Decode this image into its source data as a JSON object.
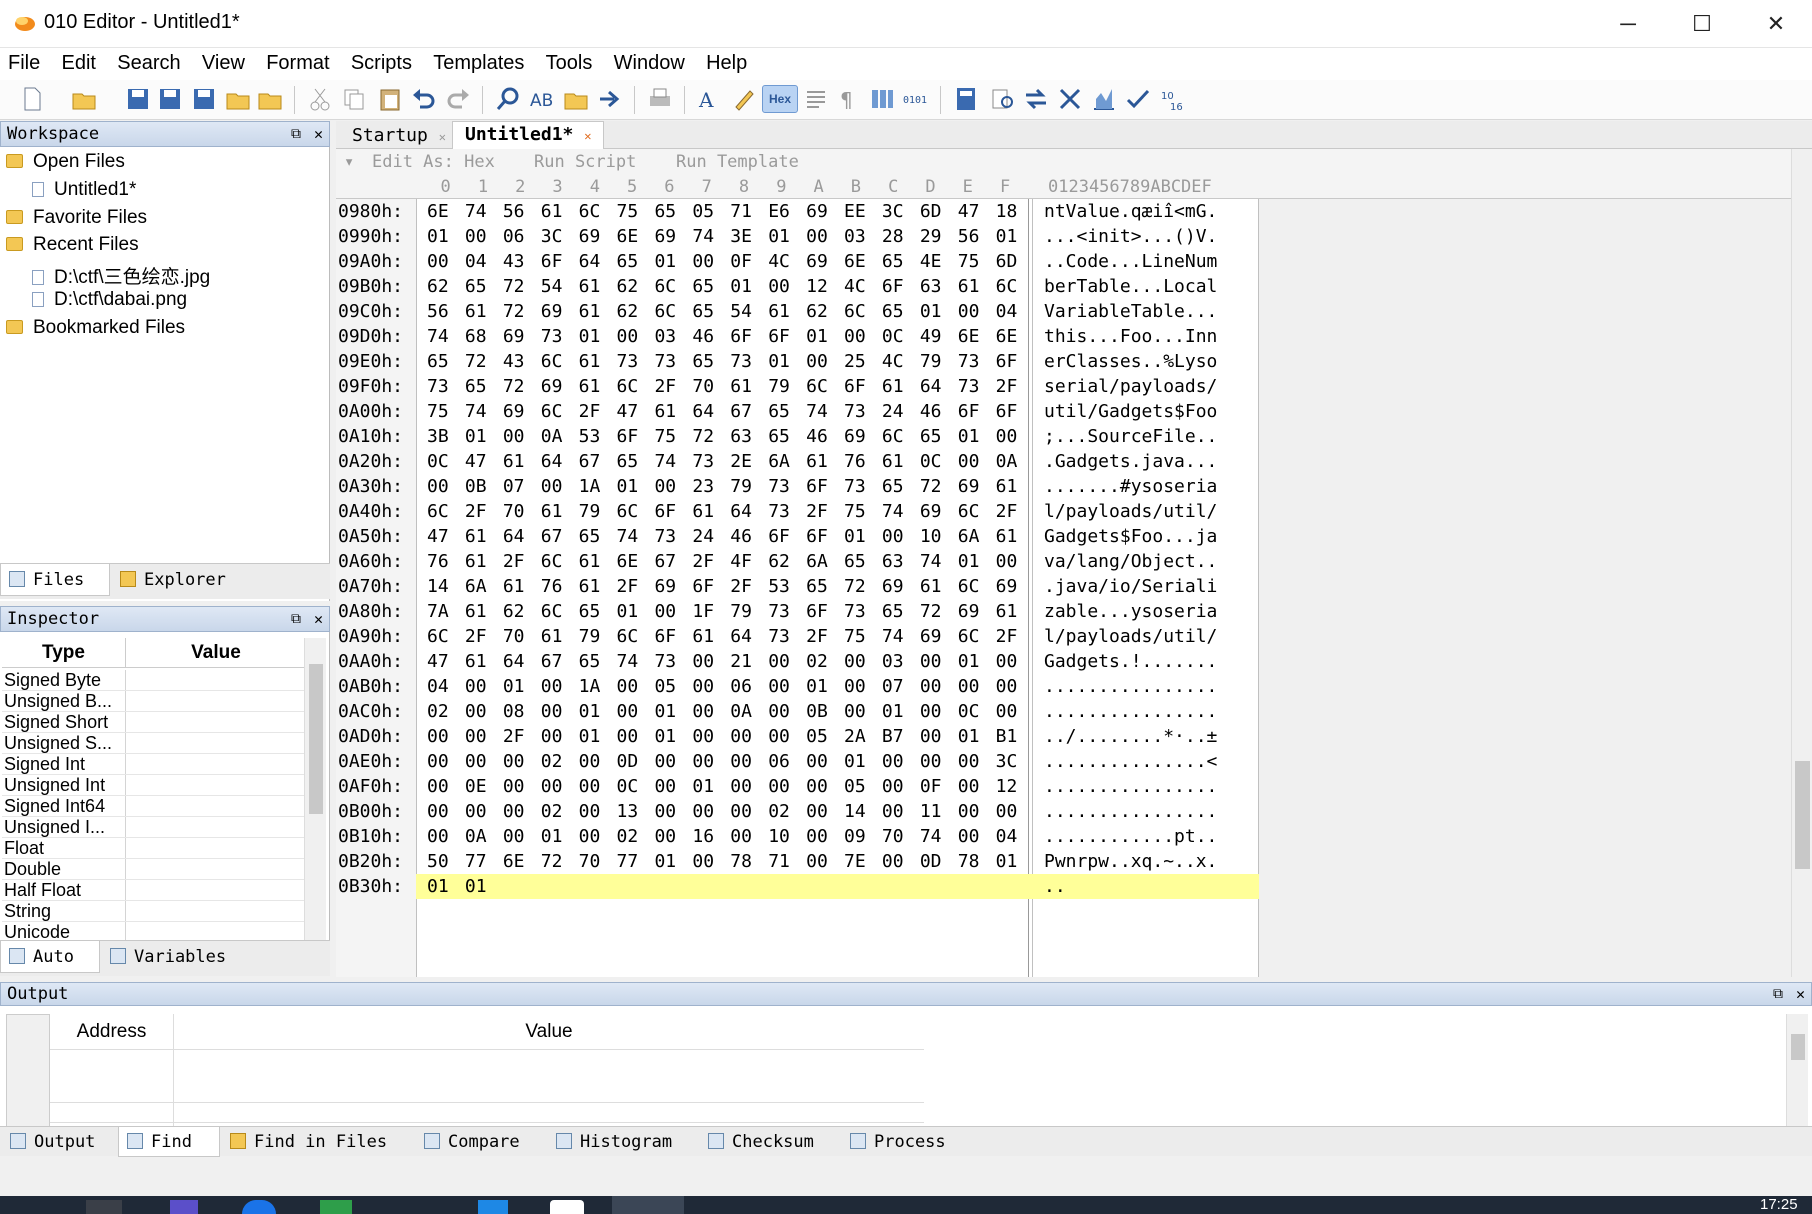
{
  "window": {
    "title": "010 Editor - Untitled1*",
    "minimize": "─",
    "maximize": "☐",
    "close": "✕"
  },
  "menu": [
    "File",
    "Edit",
    "Search",
    "View",
    "Format",
    "Scripts",
    "Templates",
    "Tools",
    "Window",
    "Help"
  ],
  "toolbar": {
    "hex_label": "Hex"
  },
  "workspace": {
    "title": "Workspace",
    "tree": {
      "open_files": "Open Files",
      "untitled": "Untitled1*",
      "favorite_files": "Favorite Files",
      "recent_files": "Recent Files",
      "recent1": "D:\\ctf\\三色绘恋.jpg",
      "recent2": "D:\\ctf\\dabai.png",
      "bookmarked_files": "Bookmarked Files"
    },
    "tabs": {
      "files": "Files",
      "explorer": "Explorer"
    }
  },
  "inspector": {
    "title": "Inspector",
    "col_type": "Type",
    "col_value": "Value",
    "rows": [
      "Signed Byte",
      "Unsigned B...",
      "Signed Short",
      "Unsigned S...",
      "Signed Int",
      "Unsigned Int",
      "Signed Int64",
      "Unsigned I...",
      "Float",
      "Double",
      "Half Float",
      "String",
      "Unicode"
    ],
    "tabs": {
      "auto": "Auto",
      "variables": "Variables"
    }
  },
  "editor": {
    "tabs": {
      "startup": "Startup",
      "untitled": "Untitled1*"
    },
    "bar": {
      "edit_as": "Edit As: Hex",
      "run_script": "Run Script",
      "run_template": "Run Template"
    },
    "col_header": [
      "0",
      "1",
      "2",
      "3",
      "4",
      "5",
      "6",
      "7",
      "8",
      "9",
      "A",
      "B",
      "C",
      "D",
      "E",
      "F"
    ],
    "ascii_header": "0123456789ABCDEF",
    "rows": [
      {
        "addr": "0980h:",
        "hex": "6E 74 56 61 6C 75 65 05 71 E6 69 EE 3C 6D 47 18",
        "ascii": "ntValue.qæiî<mG."
      },
      {
        "addr": "0990h:",
        "hex": "01 00 06 3C 69 6E 69 74 3E 01 00 03 28 29 56 01",
        "ascii": "...<init>...()V."
      },
      {
        "addr": "09A0h:",
        "hex": "00 04 43 6F 64 65 01 00 0F 4C 69 6E 65 4E 75 6D",
        "ascii": "..Code...LineNum"
      },
      {
        "addr": "09B0h:",
        "hex": "62 65 72 54 61 62 6C 65 01 00 12 4C 6F 63 61 6C",
        "ascii": "berTable...Local"
      },
      {
        "addr": "09C0h:",
        "hex": "56 61 72 69 61 62 6C 65 54 61 62 6C 65 01 00 04",
        "ascii": "VariableTable..."
      },
      {
        "addr": "09D0h:",
        "hex": "74 68 69 73 01 00 03 46 6F 6F 01 00 0C 49 6E 6E",
        "ascii": "this...Foo...Inn"
      },
      {
        "addr": "09E0h:",
        "hex": "65 72 43 6C 61 73 73 65 73 01 00 25 4C 79 73 6F",
        "ascii": "erClasses..%Lyso"
      },
      {
        "addr": "09F0h:",
        "hex": "73 65 72 69 61 6C 2F 70 61 79 6C 6F 61 64 73 2F",
        "ascii": "serial/payloads/"
      },
      {
        "addr": "0A00h:",
        "hex": "75 74 69 6C 2F 47 61 64 67 65 74 73 24 46 6F 6F",
        "ascii": "util/Gadgets$Foo"
      },
      {
        "addr": "0A10h:",
        "hex": "3B 01 00 0A 53 6F 75 72 63 65 46 69 6C 65 01 00",
        "ascii": ";...SourceFile.."
      },
      {
        "addr": "0A20h:",
        "hex": "0C 47 61 64 67 65 74 73 2E 6A 61 76 61 0C 00 0A",
        "ascii": ".Gadgets.java..."
      },
      {
        "addr": "0A30h:",
        "hex": "00 0B 07 00 1A 01 00 23 79 73 6F 73 65 72 69 61",
        "ascii": ".......#ysoseria"
      },
      {
        "addr": "0A40h:",
        "hex": "6C 2F 70 61 79 6C 6F 61 64 73 2F 75 74 69 6C 2F",
        "ascii": "l/payloads/util/"
      },
      {
        "addr": "0A50h:",
        "hex": "47 61 64 67 65 74 73 24 46 6F 6F 01 00 10 6A 61",
        "ascii": "Gadgets$Foo...ja"
      },
      {
        "addr": "0A60h:",
        "hex": "76 61 2F 6C 61 6E 67 2F 4F 62 6A 65 63 74 01 00",
        "ascii": "va/lang/Object.."
      },
      {
        "addr": "0A70h:",
        "hex": "14 6A 61 76 61 2F 69 6F 2F 53 65 72 69 61 6C 69",
        "ascii": ".java/io/Seriali"
      },
      {
        "addr": "0A80h:",
        "hex": "7A 61 62 6C 65 01 00 1F 79 73 6F 73 65 72 69 61",
        "ascii": "zable...ysoseria"
      },
      {
        "addr": "0A90h:",
        "hex": "6C 2F 70 61 79 6C 6F 61 64 73 2F 75 74 69 6C 2F",
        "ascii": "l/payloads/util/"
      },
      {
        "addr": "0AA0h:",
        "hex": "47 61 64 67 65 74 73 00 21 00 02 00 03 00 01 00",
        "ascii": "Gadgets.!......."
      },
      {
        "addr": "0AB0h:",
        "hex": "04 00 01 00 1A 00 05 00 06 00 01 00 07 00 00 00",
        "ascii": "................"
      },
      {
        "addr": "0AC0h:",
        "hex": "02 00 08 00 01 00 01 00 0A 00 0B 00 01 00 0C 00",
        "ascii": "................"
      },
      {
        "addr": "0AD0h:",
        "hex": "00 00 2F 00 01 00 01 00 00 00 05 2A B7 00 01 B1",
        "ascii": "../........*·..±"
      },
      {
        "addr": "0AE0h:",
        "hex": "00 00 00 02 00 0D 00 00 00 06 00 01 00 00 00 3C",
        "ascii": "...............<"
      },
      {
        "addr": "0AF0h:",
        "hex": "00 0E 00 00 00 0C 00 01 00 00 00 05 00 0F 00 12",
        "ascii": "................"
      },
      {
        "addr": "0B00h:",
        "hex": "00 00 00 02 00 13 00 00 00 02 00 14 00 11 00 00",
        "ascii": "................"
      },
      {
        "addr": "0B10h:",
        "hex": "00 0A 00 01 00 02 00 16 00 10 00 09 70 74 00 04",
        "ascii": "............pt.."
      },
      {
        "addr": "0B20h:",
        "hex": "50 77 6E 72 70 77 01 00 78 71 00 7E 00 0D 78 01",
        "ascii": "Pwnrpw..xq.~..x."
      },
      {
        "addr": "0B30h:",
        "hex": "01 01",
        "ascii": ".."
      }
    ]
  },
  "output": {
    "title": "Output",
    "col_address": "Address",
    "col_value": "Value",
    "tabs": {
      "output": "Output",
      "find": "Find",
      "find_in_files": "Find in Files",
      "compare": "Compare",
      "histogram": "Histogram",
      "checksum": "Checksum",
      "process": "Process"
    }
  },
  "taskbar": {
    "time": "17:25"
  },
  "colors": {
    "accent": "#2b5797",
    "highlight_row": "#ffff99",
    "panel_header": "#c9d7ea",
    "taskbar": "#1f2937"
  }
}
